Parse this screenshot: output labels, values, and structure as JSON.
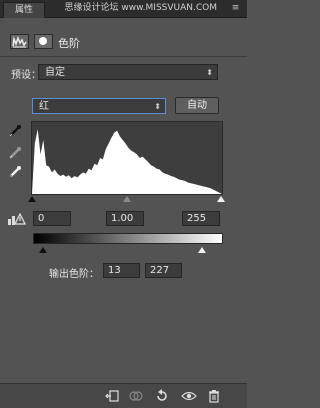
{
  "panel": {
    "tab_label": "属性",
    "watermark": "思缘设计论坛 www.MISSVUAN.COM",
    "menu_icon": "panel-menu-icon"
  },
  "header": {
    "title": "色阶",
    "icons": [
      "levels-adjustment-icon",
      "layer-mask-icon"
    ]
  },
  "preset": {
    "label": "预设：",
    "value": "自定"
  },
  "channel": {
    "value": "红",
    "auto_label": "自动"
  },
  "eyedroppers": [
    "black-point-eyedropper-icon",
    "gray-point-eyedropper-icon",
    "white-point-eyedropper-icon"
  ],
  "histogram": {
    "channel": "red",
    "levels_range": [
      0,
      255
    ],
    "bins": [
      0,
      70,
      90,
      55,
      75,
      40,
      38,
      30,
      34,
      28,
      25,
      27,
      24,
      26,
      22,
      25,
      23,
      27,
      30,
      28,
      35,
      33,
      42,
      40,
      50,
      48,
      62,
      70,
      78,
      85,
      88,
      80,
      75,
      70,
      64,
      60,
      58,
      55,
      50,
      52,
      48,
      44,
      40,
      38,
      35,
      34,
      30,
      28,
      27,
      25,
      24,
      22,
      20,
      19,
      18,
      16,
      15,
      14,
      13,
      12,
      11,
      10,
      9,
      8,
      6,
      4,
      2,
      0
    ]
  },
  "input_levels": {
    "black": "0",
    "gamma": "1.00",
    "white": "255"
  },
  "output_levels": {
    "label": "输出色阶：",
    "black": "13",
    "white": "227",
    "black_value": 13,
    "white_value": 227
  },
  "toolbar": {
    "icons": [
      "clip-to-layer-icon",
      "view-previous-state-icon",
      "reset-icon",
      "visibility-eye-icon",
      "delete-trash-icon"
    ]
  },
  "colors": {
    "panel_bg": "#535353",
    "field_bg": "#3c3c3c",
    "histogram_fill": "#ffffff",
    "focus_border": "#5d8fd6"
  }
}
